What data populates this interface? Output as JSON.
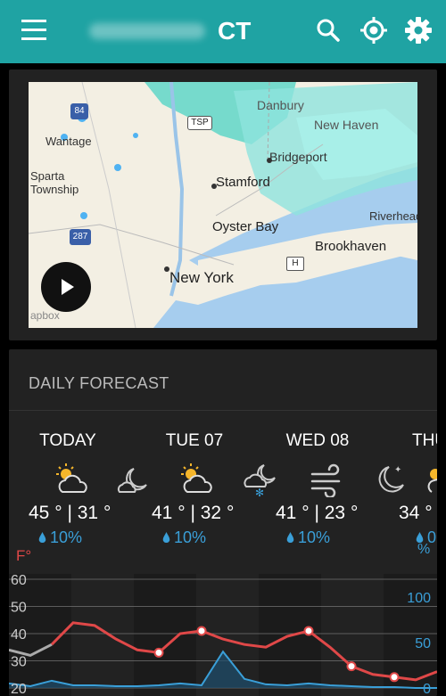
{
  "appbar": {
    "title": "CT",
    "menu_icon": "hamburger-menu-icon",
    "search_icon": "search-icon",
    "location_icon": "my-location-icon",
    "settings_icon": "gear-icon",
    "bg": "#1fa3a3"
  },
  "map": {
    "labels": [
      "Danbury",
      "New Haven",
      "Wantage",
      "Bridgeport",
      "Sparta Township",
      "Stamford",
      "Riverhead",
      "Oyster Bay",
      "Brookhaven",
      "New York"
    ],
    "shields": [
      "84",
      "TSP",
      "287",
      "H"
    ],
    "attribution": "apbox",
    "play_icon": "play-icon"
  },
  "forecast": {
    "title": "DAILY FORECAST",
    "days": [
      {
        "label": "TODAY",
        "day_icon": "partly-cloudy-day-icon",
        "night_icon": "clear-night-moon-icon",
        "hi": "45 °",
        "lo": "31 °",
        "sep": "|",
        "precip": "10%"
      },
      {
        "label": "TUE 07",
        "day_icon": "partly-cloudy-day-icon",
        "night_icon": "snow-night-cloud-icon",
        "hi": "41 °",
        "lo": "32 °",
        "sep": "|",
        "precip": "10%"
      },
      {
        "label": "WED 08",
        "day_icon": "wind-icon",
        "night_icon": "clear-night-stars-icon",
        "hi": "41 °",
        "lo": "23 °",
        "sep": "|",
        "precip": "10%"
      },
      {
        "label": "THU",
        "day_icon": "partly-cloudy-day-icon",
        "night_icon": "",
        "hi": "34 °",
        "lo": "",
        "sep": "",
        "precip": "0"
      }
    ],
    "unit_temp": "F°",
    "unit_precip": "%",
    "colors": {
      "temp_line": "#e04848",
      "precip_line": "#3a9fd8",
      "past_line": "#aaaaaa"
    }
  },
  "chart_data": {
    "type": "line",
    "title": "",
    "xlabel": "",
    "ylabel": "F°",
    "y2label": "%",
    "ylim": [
      20,
      60
    ],
    "y2lim": [
      0,
      100
    ],
    "yticks": [
      "60",
      "50",
      "40",
      "30",
      "20"
    ],
    "y2ticks": [
      "100",
      "50",
      "0"
    ],
    "grid": true,
    "series": [
      {
        "name": "",
        "axis": "left",
        "x": [
          0,
          1,
          2,
          3,
          4,
          5,
          6,
          7,
          8,
          9,
          10,
          11,
          12,
          13,
          14,
          15,
          16,
          17,
          18,
          19,
          20
        ],
        "values": [
          34,
          32,
          36,
          44,
          43,
          38,
          34,
          33,
          40,
          41,
          38,
          36,
          35,
          39,
          41,
          35,
          28,
          25,
          24,
          23,
          26
        ]
      },
      {
        "name": "",
        "axis": "right",
        "x": [
          0,
          1,
          2,
          3,
          4,
          5,
          6,
          7,
          8,
          9,
          10,
          11,
          12,
          13,
          14,
          15,
          16,
          17,
          18,
          19,
          20
        ],
        "values": [
          5,
          2,
          8,
          3,
          3,
          2,
          2,
          3,
          5,
          3,
          40,
          10,
          4,
          3,
          5,
          3,
          2,
          1,
          1,
          0,
          0
        ]
      }
    ],
    "highlight_points": [
      {
        "x": 7,
        "y": 33
      },
      {
        "x": 9,
        "y": 41
      },
      {
        "x": 14,
        "y": 41
      },
      {
        "x": 16,
        "y": 28
      },
      {
        "x": 18,
        "y": 24
      }
    ]
  }
}
